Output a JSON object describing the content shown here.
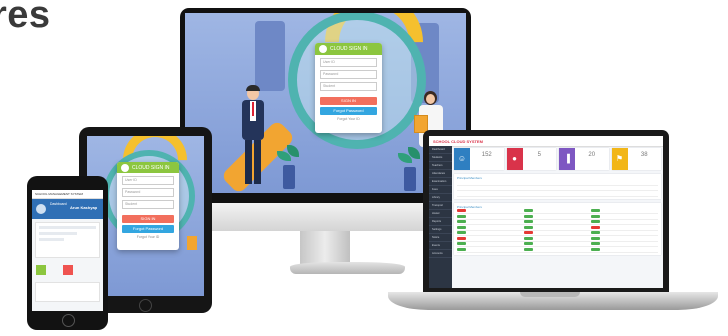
{
  "heading": {
    "text": "res"
  },
  "desktop_login": {
    "title": "CLOUD SIGN IN",
    "field_user": "User ID",
    "field_pass": "Password",
    "field_role": "Student",
    "sign_in": "SIGN IN",
    "forgot": "Forgot Password",
    "link": "Forgot Your ID"
  },
  "tablet_login": {
    "title": "CLOUD SIGN IN",
    "field_user": "User ID",
    "field_pass": "Password",
    "field_role": "Student",
    "sign_in": "SIGN IN",
    "forgot": "Forgot Password",
    "link": "Forgot Your ID"
  },
  "phone": {
    "app_title": "SCHOOL MANAGEMENT SYSTEM",
    "user_name": "Arun Kashyap",
    "tab_label": "Dashboard"
  },
  "laptop": {
    "brand": "SCHOOL CLOUD SYSTEM",
    "sidebar": [
      "Dashboard",
      "Students",
      "Teachers",
      "Attendance",
      "Examination",
      "Fees",
      "Library",
      "Transport",
      "Hostel",
      "Reports",
      "Settings",
      "Notice",
      "Events",
      "Accounts"
    ],
    "tiles": [
      {
        "icon": "users-icon",
        "value": "152",
        "color": "#2f7fc1"
      },
      {
        "icon": "chat-icon",
        "value": "5",
        "color": "#d9334a"
      },
      {
        "icon": "chart-icon",
        "value": "20",
        "color": "#7e57c2"
      },
      {
        "icon": "person-icon",
        "value": "38",
        "color": "#f2b618"
      }
    ],
    "panel1_title": "Principal Members",
    "panel2_title": "Principal Members",
    "pill_colors": [
      "#4caf50",
      "#e53935"
    ]
  },
  "colors": {
    "login_header": "#8cc63f",
    "sign_in": "#f26f5d",
    "forgot": "#33a6e0"
  }
}
